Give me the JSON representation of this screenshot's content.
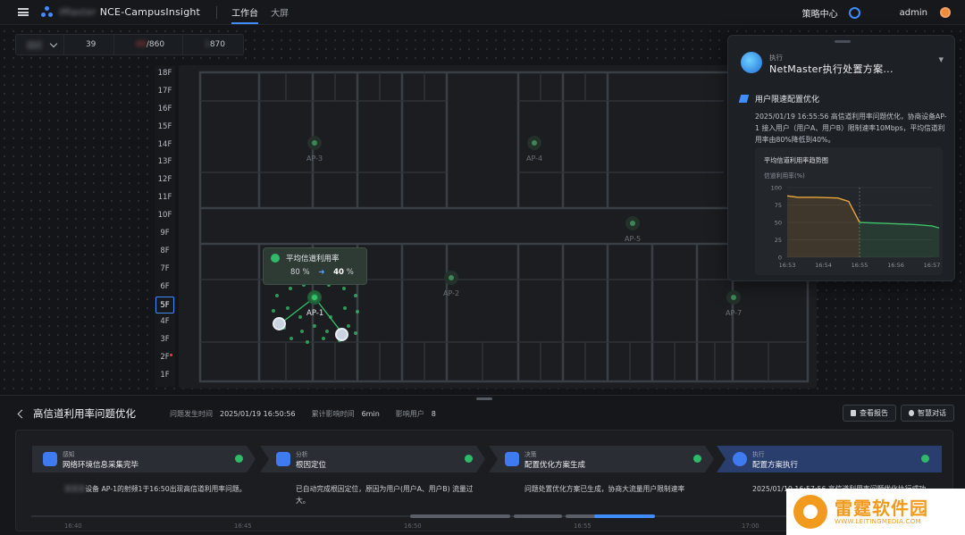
{
  "topbar": {
    "app_title": "NCE-CampusInsight",
    "app_title_prefix": "iMaster",
    "tab_workbench": "工作台",
    "tab_bigscreen": "大屏",
    "strategy_center": "策略中心",
    "admin": "admin"
  },
  "filter": {
    "select_value": "园区",
    "v1": "39",
    "v2": "/860",
    "v2_prefix": "60",
    "v3": "870",
    "v3_prefix": "1"
  },
  "floors": [
    "18F",
    "17F",
    "16F",
    "15F",
    "14F",
    "13F",
    "12F",
    "11F",
    "10F",
    "9F",
    "8F",
    "7F",
    "6F",
    "5F",
    "4F",
    "3F",
    "2F",
    "1F"
  ],
  "active_floor": "5F",
  "alarm_floor": "2F",
  "map": {
    "aps": [
      {
        "label": "AP-3",
        "active": false
      },
      {
        "label": "AP-4",
        "active": false
      },
      {
        "label": "AP-5",
        "active": false
      },
      {
        "label": "AP-2",
        "active": false
      },
      {
        "label": "AP-7",
        "active": false
      },
      {
        "label": "AP-1",
        "active": true
      }
    ],
    "tooltip": {
      "title": "平均信道利用率",
      "from": "80",
      "to": "40",
      "unit": "%"
    }
  },
  "panel": {
    "exec_label": "执行",
    "exec_title": "NetMaster执行处置方案...",
    "section_title": "用户限速配置优化",
    "section_body": "2025/01/19   16:55:56 高信道利用率问题优化，协商设备AP-1 接入用户（用户A、用户B）限制速率10Mbps，平均信道利用率由80%降低到40%。",
    "chart_title": "平均信道利用率趋势图",
    "chart_ylabel": "信道利用率(%)"
  },
  "chart_data": {
    "type": "line",
    "title": "平均信道利用率趋势图",
    "ylabel": "信道利用率(%)",
    "ylim": [
      0,
      100
    ],
    "yticks": [
      "100",
      "75",
      "50",
      "25",
      "0"
    ],
    "xticks": [
      "16:53",
      "16:54",
      "16:55",
      "16:56",
      "16:57"
    ],
    "series": [
      {
        "color": "#e9a63a",
        "x": [
          0,
          0.3,
          0.8,
          1.4,
          1.7,
          1.9,
          2.0
        ],
        "values": [
          88,
          86,
          86,
          85,
          80,
          60,
          50
        ]
      },
      {
        "color": "#3fbf6a",
        "x": [
          2.0,
          2.5,
          3.0,
          3.5,
          4.0,
          4.2
        ],
        "values": [
          50,
          49,
          48,
          47,
          45,
          42
        ]
      }
    ],
    "marker_x": 2.0
  },
  "bottom": {
    "title": "高信道利用率问题优化",
    "occur_label": "问题发生时间",
    "occur_value": "2025/01/19  16:50:56",
    "impact_label": "累计影响时间",
    "impact_value": "6min",
    "users_label": "影响用户",
    "users_value": "8",
    "btn_report": "查看报告",
    "btn_chat": "智慧对话",
    "steps": [
      {
        "small": "感知",
        "big": "网络环境信息采集完毕",
        "desc": "设备 AP-1的射频1于16:50出现高信道利用率问题。",
        "desc_prefix": "某某某"
      },
      {
        "small": "分析",
        "big": "根因定位",
        "desc": "已自动完成根因定位，原因为用户(用户A、用户B) 流量过大。"
      },
      {
        "small": "决策",
        "big": "配置优化方案生成",
        "desc": "问题处置优化方案已生成，协商大流量用户限制速率"
      },
      {
        "small": "执行",
        "big": "配置方案执行",
        "desc": "2025/01/19  16:57:56 高信道利用率问题优化执行成功"
      }
    ],
    "ticks": [
      "16:40",
      "16:45",
      "16:50",
      "16:55",
      "17:00"
    ]
  },
  "watermark": {
    "big": "雷霆软件园",
    "url": "WWW.LEITINGMEDIA.COM"
  }
}
